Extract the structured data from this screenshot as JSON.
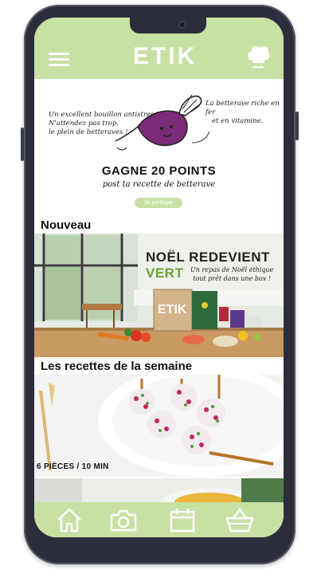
{
  "header": {
    "logo": "ETIK",
    "menu_icon": "hamburger-icon",
    "profile_icon": "chef-hat-icon"
  },
  "promo": {
    "left_note": [
      "Un excellent bouillon antistress,",
      "N'attendez pas trop,",
      "le plein de betteraves !"
    ],
    "right_note": [
      "La betterave riche en fer",
      "et en vitamine."
    ],
    "headline": "GAGNE 20 POINTS",
    "subline": "post ta recette de betterave",
    "button": "Je participe"
  },
  "sections": {
    "nouveau": "Nouveau",
    "recettes": "Les recettes de la semaine"
  },
  "noel_banner": {
    "title_part1": "NOËL REDEVIENT",
    "title_part2": "VERT",
    "subtitle": [
      "Un repas de Noël éthique",
      "tout prêt dans une box !"
    ],
    "box_logo": "ETIK"
  },
  "recipe_card": {
    "caption": "6 PIÈCES / 10 MIN"
  },
  "bottom_nav": {
    "items": [
      "home-icon",
      "camera-icon",
      "calendar-icon",
      "basket-icon"
    ]
  },
  "colors": {
    "accent_green": "#c8e0a4",
    "brand_green": "#6aa12f",
    "beet_purple": "#7b2a76",
    "frame": "#2b2d3a"
  }
}
